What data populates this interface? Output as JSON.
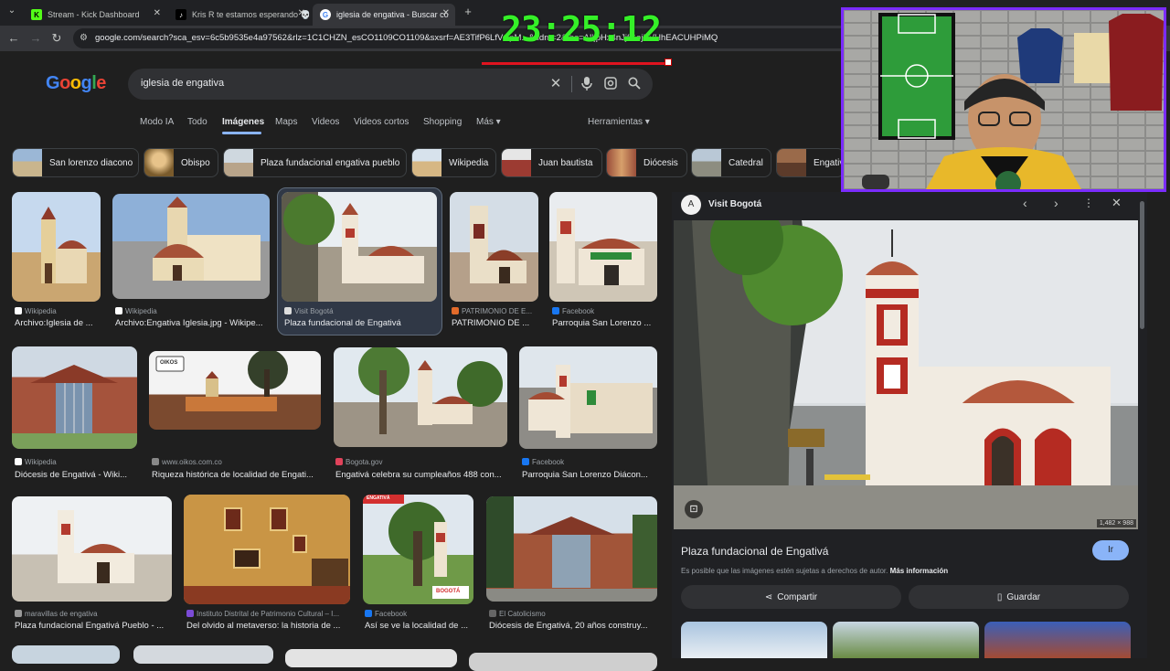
{
  "browser": {
    "tabs": [
      {
        "title": "Stream - Kick Dashboard",
        "favicon": "K"
      },
      {
        "title": "Kris R te estamos esperando 💀",
        "favicon": "♪"
      },
      {
        "title": "iglesia de engativa - Buscar co",
        "favicon": "G"
      }
    ],
    "url": "google.com/search?sca_esv=6c5b9535e4a97562&rlz=1C1CHZN_esCO1109CO1109&sxsrf=AE3TifP6LfVCpM...&udm=2&fbs=AIljpHx4nJjfGojPVHhEACUHPiMQ"
  },
  "overlay": {
    "clock": "23:25:12"
  },
  "google": {
    "logo": "Google",
    "query": "iglesia de engativa",
    "nav": [
      "Modo IA",
      "Todo",
      "Imágenes",
      "Maps",
      "Videos",
      "Videos cortos",
      "Shopping",
      "Más ▾"
    ],
    "tools": "Herramientas ▾",
    "chips": [
      "San lorenzo diacono",
      "Obispo",
      "Plaza fundacional engativa pueblo",
      "Wikipedia",
      "Juan bautista",
      "Diócesis",
      "Catedral",
      "Engativ"
    ]
  },
  "results": [
    {
      "source": "Wikipedia",
      "title": "Archivo:Iglesia de ..."
    },
    {
      "source": "Wikipedia",
      "title": "Archivo:Engativa Iglesia.jpg - Wikipe..."
    },
    {
      "source": "Visit Bogotá",
      "title": "Plaza fundacional de Engativá"
    },
    {
      "source": "PATRIMONIO DE E...",
      "title": "PATRIMONIO DE ..."
    },
    {
      "source": "Facebook",
      "title": "Parroquia San Lorenzo ..."
    },
    {
      "source": "Wikipedia",
      "title": "Diócesis de Engativá - Wiki..."
    },
    {
      "source": "www.oikos.com.co",
      "title": "Riqueza histórica de localidad de Engati..."
    },
    {
      "source": "Bogota.gov",
      "title": "Engativá celebra su cumpleaños 488 con..."
    },
    {
      "source": "Facebook",
      "title": "Parroquia San Lorenzo Diácon..."
    },
    {
      "source": "maravillas de engativa",
      "title": "Plaza fundacional Engativá Pueblo - ..."
    },
    {
      "source": "Instituto Distrital de Patrimonio Cultural – I...",
      "title": "Del olvido al metaverso: la historia de ..."
    },
    {
      "source": "Facebook",
      "title": "Así se ve la localidad de ..."
    },
    {
      "source": "El Catolicismo",
      "title": "Diócesis de Engativá, 20 años construy..."
    }
  ],
  "panel": {
    "site": "Visit Bogotá",
    "dims": "1,482 × 988",
    "title": "Plaza fundacional de Engativá",
    "visit": "Ir",
    "note": "Es posible que las imágenes estén sujetas a derechos de autor.",
    "more": "Más información",
    "share": "Compartir",
    "save": "Guardar"
  },
  "stamps": {
    "oikos": "OIKOS",
    "bogota": "BOGOTÁ",
    "engativa": "ENGATIVÁ"
  },
  "colors": {
    "accent": "#8ab4f8",
    "bg": "#1f1f1f",
    "clock": "#35f028",
    "cam_border": "#7b2cff"
  }
}
